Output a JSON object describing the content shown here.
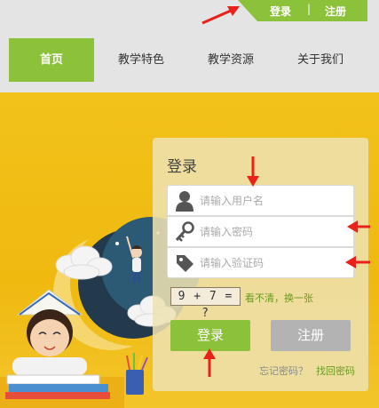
{
  "header": {
    "login_link": "登录",
    "separator": "|",
    "register_link": "注册"
  },
  "nav": {
    "items": [
      {
        "label": "首页",
        "active": true
      },
      {
        "label": "教学特色",
        "active": false
      },
      {
        "label": "教学资源",
        "active": false
      },
      {
        "label": "关于我们",
        "active": false
      }
    ]
  },
  "login_form": {
    "title": "登录",
    "username_placeholder": "请输入用户名",
    "password_placeholder": "请输入密码",
    "captcha_placeholder": "请输入验证码",
    "captcha_text": "9 + 7 = ?",
    "refresh_text": "看不清，换一张",
    "login_button": "登录",
    "register_button": "注册",
    "forgot_text": "忘记密码？",
    "find_password": "找回密码"
  },
  "icons": {
    "username": "user-icon",
    "password": "key-icon",
    "captcha": "tag-icon"
  },
  "colors": {
    "accent_green": "#8cc13a",
    "banner_yellow": "#f0bd13",
    "annotation_red": "#e8221a",
    "register_gray": "#b3b3b3"
  }
}
